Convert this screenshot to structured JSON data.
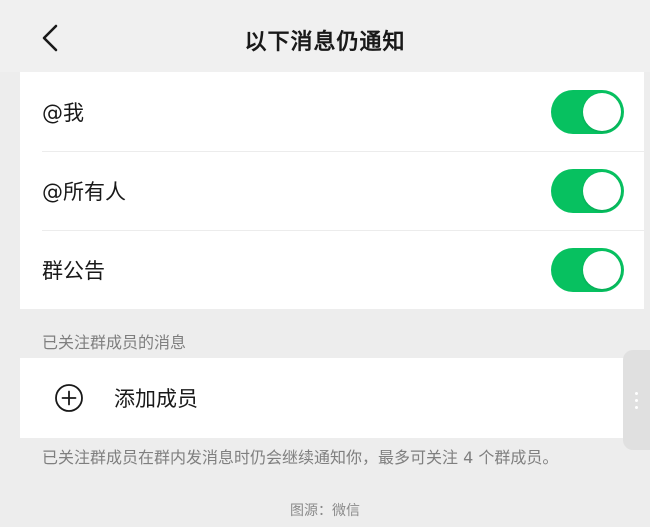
{
  "header": {
    "title": "以下消息仍通知",
    "back_icon": "chevron-left-icon"
  },
  "toggles": [
    {
      "label": "@我",
      "on": true
    },
    {
      "label": "@所有人",
      "on": true
    },
    {
      "label": "群公告",
      "on": true
    }
  ],
  "followed_section": {
    "caption": "已关注群成员的消息",
    "add_label": "添加成员",
    "add_icon": "plus-circle-icon",
    "footnote": "已关注群成员在群内发消息时仍会继续通知你，最多可关注 4 个群成员。"
  },
  "source_caption": "图源：微信",
  "colors": {
    "accent": "#07c160",
    "background": "#ededed",
    "card": "#ffffff",
    "secondary_text": "#7f7f7f"
  }
}
